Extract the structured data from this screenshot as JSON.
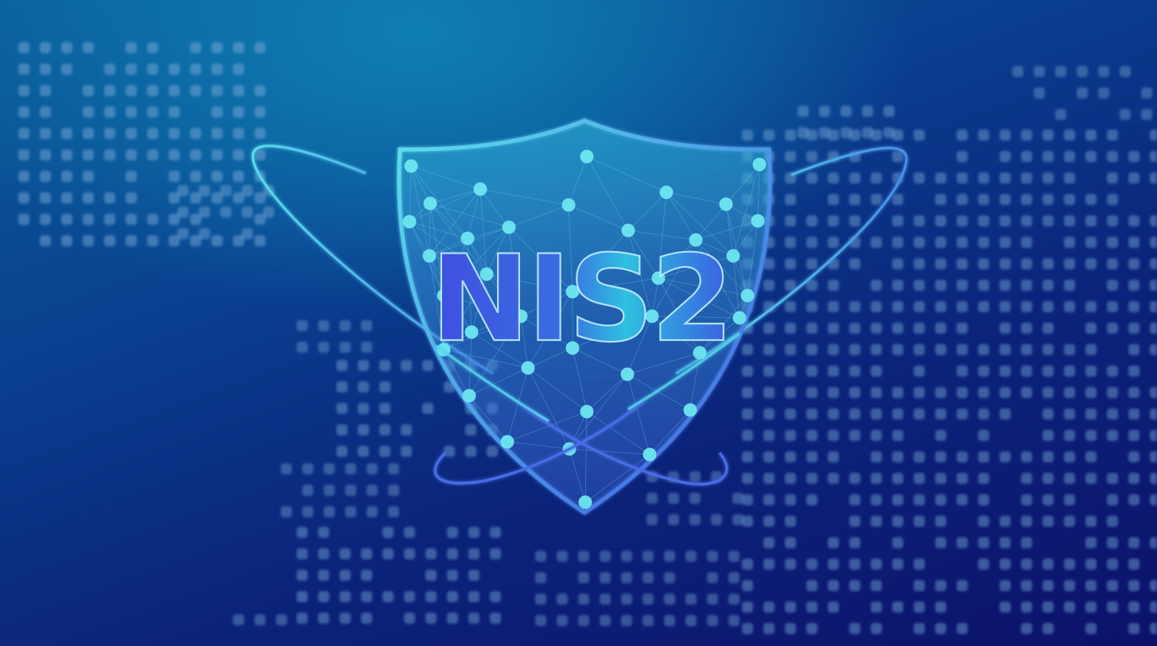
{
  "emblem": {
    "title": "NIS2",
    "icon": "shield-icon"
  },
  "colors": {
    "background_dark": "#0c126b",
    "background_light": "#0a6fa8",
    "shield_outline": "#4fd3e6",
    "node_fill": "#6fe6f0",
    "text_gradient_start": "#3b5be0",
    "text_gradient_end": "#2fc6e0",
    "map_dots": "#7aa9d8"
  }
}
